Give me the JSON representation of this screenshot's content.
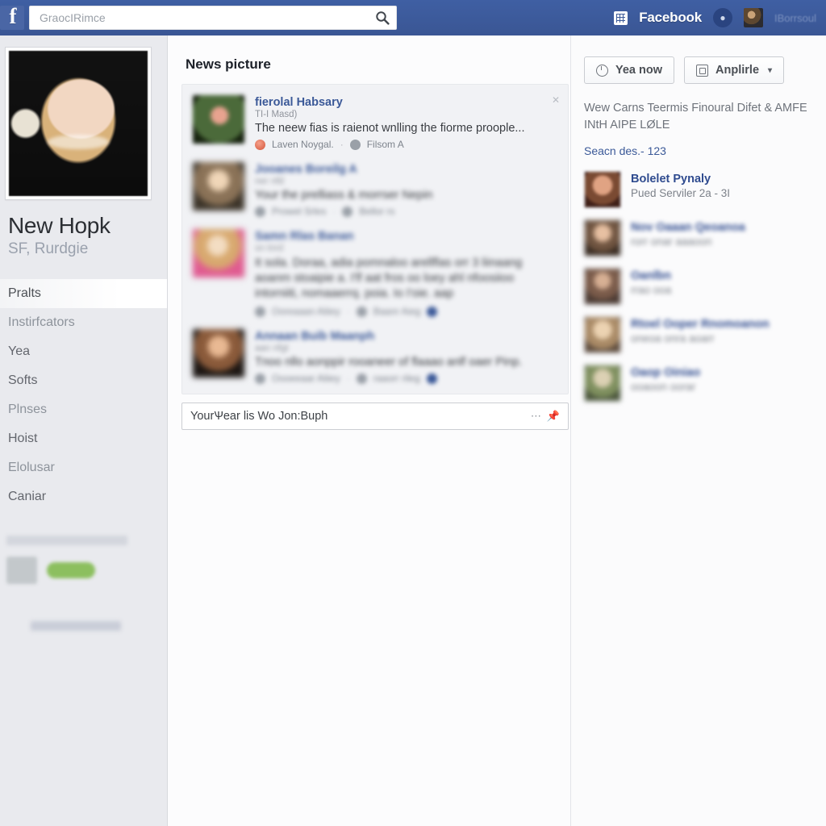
{
  "topbar": {
    "logo": "f",
    "search_placeholder": "GraocIRimce",
    "search_value": "",
    "search_icon": "search-icon",
    "grid_icon": "grid-icon",
    "app_label": "Facebook",
    "messenger_icon": "messenger-icon",
    "account_name": "IBorrsoul"
  },
  "sidebar": {
    "profile_name": "New Hopk",
    "profile_subtitle": "SF, Rurdgie",
    "nav": [
      {
        "label": "Pralts",
        "active": true
      },
      {
        "label": "Instirfcators",
        "active": false
      },
      {
        "label": "Yea",
        "active": false
      },
      {
        "label": "Softs",
        "active": false
      },
      {
        "label": "Plnses",
        "active": false
      },
      {
        "label": "Hoist",
        "active": false
      },
      {
        "label": "Elolusar",
        "active": false
      },
      {
        "label": "Caniar",
        "active": false
      }
    ]
  },
  "feed": {
    "title": "News picture",
    "posts": [
      {
        "author": "fierolal Habsary",
        "meta": "TI-I Masd)",
        "text": "The neew fias is raienot wnlling the fiorme proople...",
        "action_left": "Laven Noygal.",
        "action_right": "Filsom A",
        "blur": "blur-0",
        "thumb": "thumb-1"
      },
      {
        "author": "Jooanes Boreilg A",
        "meta": "ner nfd",
        "text": "Your the prelliass & morrser Nepin",
        "action_left": "Prowel Srles",
        "action_right": "Bellor rs",
        "blur": "blur-2",
        "thumb": "thumb-2"
      },
      {
        "author": "Samn Rlas Banan",
        "meta": "sn tnrd",
        "text": "It sola. Doraa, adia pomnaloo arellflas orr 3 liinaang aoanm stoaipie a. I'lf aat fros oo loey ahl nfoosiioo intorniiti, nomaaerrq. poia. Io I'oie. aap",
        "action_left": "Ooreaaan Aliiey",
        "action_right": "Baanr Aieg",
        "blur": "blur-3",
        "thumb": "thumb-3"
      },
      {
        "author": "Annaan Buib Maanph",
        "meta": "aan nfgt",
        "text": "Tnoo nllo aonppir rooaneer of flaaao anlf oaer Pinp.",
        "action_left": "Oooeeaar Aliiey",
        "action_right": "raaorr rileg",
        "blur": "blur-2",
        "thumb": "thumb-4"
      }
    ],
    "composer_value": "YourѰear lis Wo Jon:Buph",
    "composer_icons": [
      "more-icon",
      "pin-icon"
    ]
  },
  "rightpanel": {
    "buttons": [
      {
        "label": "Yea now",
        "icon": "clock-icon",
        "caret": false
      },
      {
        "label": "Anplirle",
        "icon": "photo-icon",
        "caret": true,
        "caret_glyph": "▾"
      }
    ],
    "headline_line1": "Wew Carns Teermis Finoural Difet & AMFE",
    "headline_line2": "INtH AIPE LØLE",
    "subline": "Seacn des.- 123",
    "list": [
      {
        "name": "Bolelet Pynaly",
        "sub": "Pued Serviler 2a - 3I",
        "blur": false,
        "avatar": "av-1"
      },
      {
        "name": "Nov Oaaan Qeoanoa",
        "sub": "rorr onar aaaoon",
        "blur": true,
        "avatar": "av-2"
      },
      {
        "name": "Oanlbn",
        "sub": "rrao ooa",
        "blur": true,
        "avatar": "av-3"
      },
      {
        "name": "Rtoel Ooper Rnomoanon",
        "sub": "oneoa onra aoarr",
        "blur": true,
        "avatar": "av-4"
      },
      {
        "name": "Oaop Oiniao",
        "sub": "ooaoon oorar",
        "blur": true,
        "avatar": "av-5"
      }
    ]
  },
  "colors": {
    "brand_blue": "#3b5998",
    "link_blue": "#3b5998",
    "sidebar_bg": "#e9eaee",
    "card_bg": "#f1f2f5",
    "promo_green": "#8cbf5f"
  }
}
